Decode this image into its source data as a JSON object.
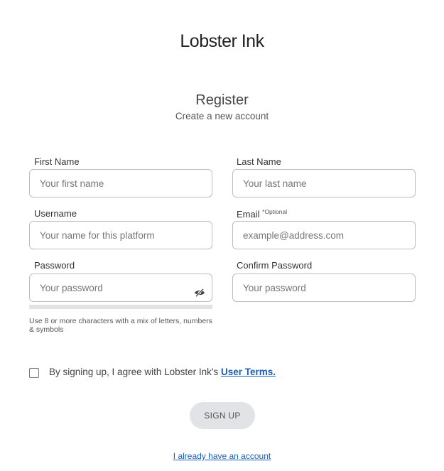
{
  "brand": {
    "logo_text": "Lobster Ink"
  },
  "header": {
    "title": "Register",
    "subtitle": "Create a new account"
  },
  "form": {
    "first_name": {
      "label": "First Name",
      "placeholder": "Your first name",
      "value": ""
    },
    "last_name": {
      "label": "Last Name",
      "placeholder": "Your last name",
      "value": ""
    },
    "username": {
      "label": "Username",
      "placeholder": "Your name for this platform",
      "value": ""
    },
    "email": {
      "label": "Email",
      "optional_tag": "*Optional",
      "placeholder": "example@address.com",
      "value": ""
    },
    "password": {
      "label": "Password",
      "placeholder": "Your password",
      "value": "",
      "toggle_icon": "eye-slash-icon",
      "strength": 0
    },
    "confirm_password": {
      "label": "Confirm Password",
      "placeholder": "Your password",
      "value": ""
    },
    "password_hint": "Use 8 or more characters with a mix of letters, numbers & symbols",
    "terms": {
      "checked": false,
      "text": "By signing up, I agree with Lobster Ink's ",
      "link_label": "User Terms."
    },
    "submit_label": "SIGN UP",
    "login_link_label": "I already have an account"
  },
  "colors": {
    "link": "#1a5fb4",
    "button_bg": "#e2e3e6",
    "border": "#bdbdbd"
  }
}
